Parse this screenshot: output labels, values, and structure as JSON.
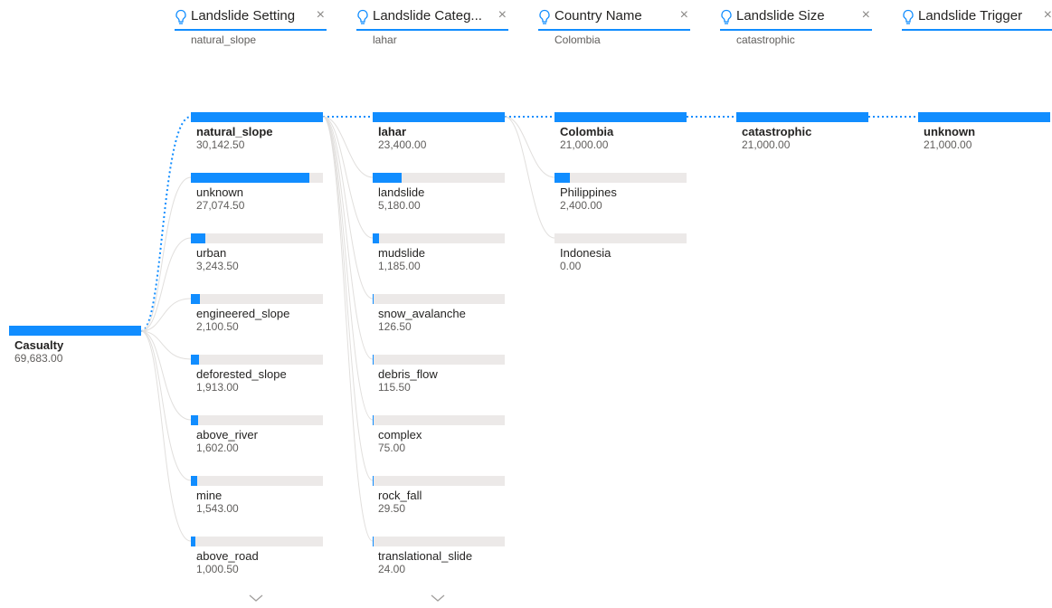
{
  "colors": {
    "accent": "#118DFF",
    "track": "#ECE9E8",
    "link": "#E1DFDD",
    "text": "#252423",
    "muted": "#605e5c"
  },
  "root": {
    "label": "Casualty",
    "value": "69,683.00",
    "amount": 69683.0
  },
  "levels": [
    {
      "header": {
        "title": "Landslide Setting",
        "subtitle": "natural_slope",
        "icon": "lightbulb-icon"
      },
      "has_more": true,
      "nodes": [
        {
          "label": "natural_slope",
          "value": "30,142.50",
          "amount": 30142.5,
          "selected": true
        },
        {
          "label": "unknown",
          "value": "27,074.50",
          "amount": 27074.5
        },
        {
          "label": "urban",
          "value": "3,243.50",
          "amount": 3243.5
        },
        {
          "label": "engineered_slope",
          "value": "2,100.50",
          "amount": 2100.5
        },
        {
          "label": "deforested_slope",
          "value": "1,913.00",
          "amount": 1913.0
        },
        {
          "label": "above_river",
          "value": "1,602.00",
          "amount": 1602.0
        },
        {
          "label": "mine",
          "value": "1,543.00",
          "amount": 1543.0
        },
        {
          "label": "above_road",
          "value": "1,000.50",
          "amount": 1000.5
        }
      ]
    },
    {
      "header": {
        "title": "Landslide Categ...",
        "subtitle": "lahar",
        "icon": "lightbulb-icon"
      },
      "has_more": true,
      "nodes": [
        {
          "label": "lahar",
          "value": "23,400.00",
          "amount": 23400.0,
          "selected": true
        },
        {
          "label": "landslide",
          "value": "5,180.00",
          "amount": 5180.0
        },
        {
          "label": "mudslide",
          "value": "1,185.00",
          "amount": 1185.0
        },
        {
          "label": "snow_avalanche",
          "value": "126.50",
          "amount": 126.5
        },
        {
          "label": "debris_flow",
          "value": "115.50",
          "amount": 115.5
        },
        {
          "label": "complex",
          "value": "75.00",
          "amount": 75.0
        },
        {
          "label": "rock_fall",
          "value": "29.50",
          "amount": 29.5
        },
        {
          "label": "translational_slide",
          "value": "24.00",
          "amount": 24.0
        }
      ]
    },
    {
      "header": {
        "title": "Country Name",
        "subtitle": "Colombia",
        "icon": "lightbulb-icon"
      },
      "has_more": false,
      "nodes": [
        {
          "label": "Colombia",
          "value": "21,000.00",
          "amount": 21000.0,
          "selected": true
        },
        {
          "label": "Philippines",
          "value": "2,400.00",
          "amount": 2400.0
        },
        {
          "label": "Indonesia",
          "value": "0.00",
          "amount": 0.0
        }
      ]
    },
    {
      "header": {
        "title": "Landslide Size",
        "subtitle": "catastrophic",
        "icon": "lightbulb-icon"
      },
      "has_more": false,
      "nodes": [
        {
          "label": "catastrophic",
          "value": "21,000.00",
          "amount": 21000.0,
          "selected": true
        }
      ]
    },
    {
      "header": {
        "title": "Landslide Trigger",
        "subtitle": "",
        "icon": "lightbulb-icon"
      },
      "has_more": false,
      "nodes": [
        {
          "label": "unknown",
          "value": "21,000.00",
          "amount": 21000.0,
          "selected": true
        }
      ]
    }
  ]
}
